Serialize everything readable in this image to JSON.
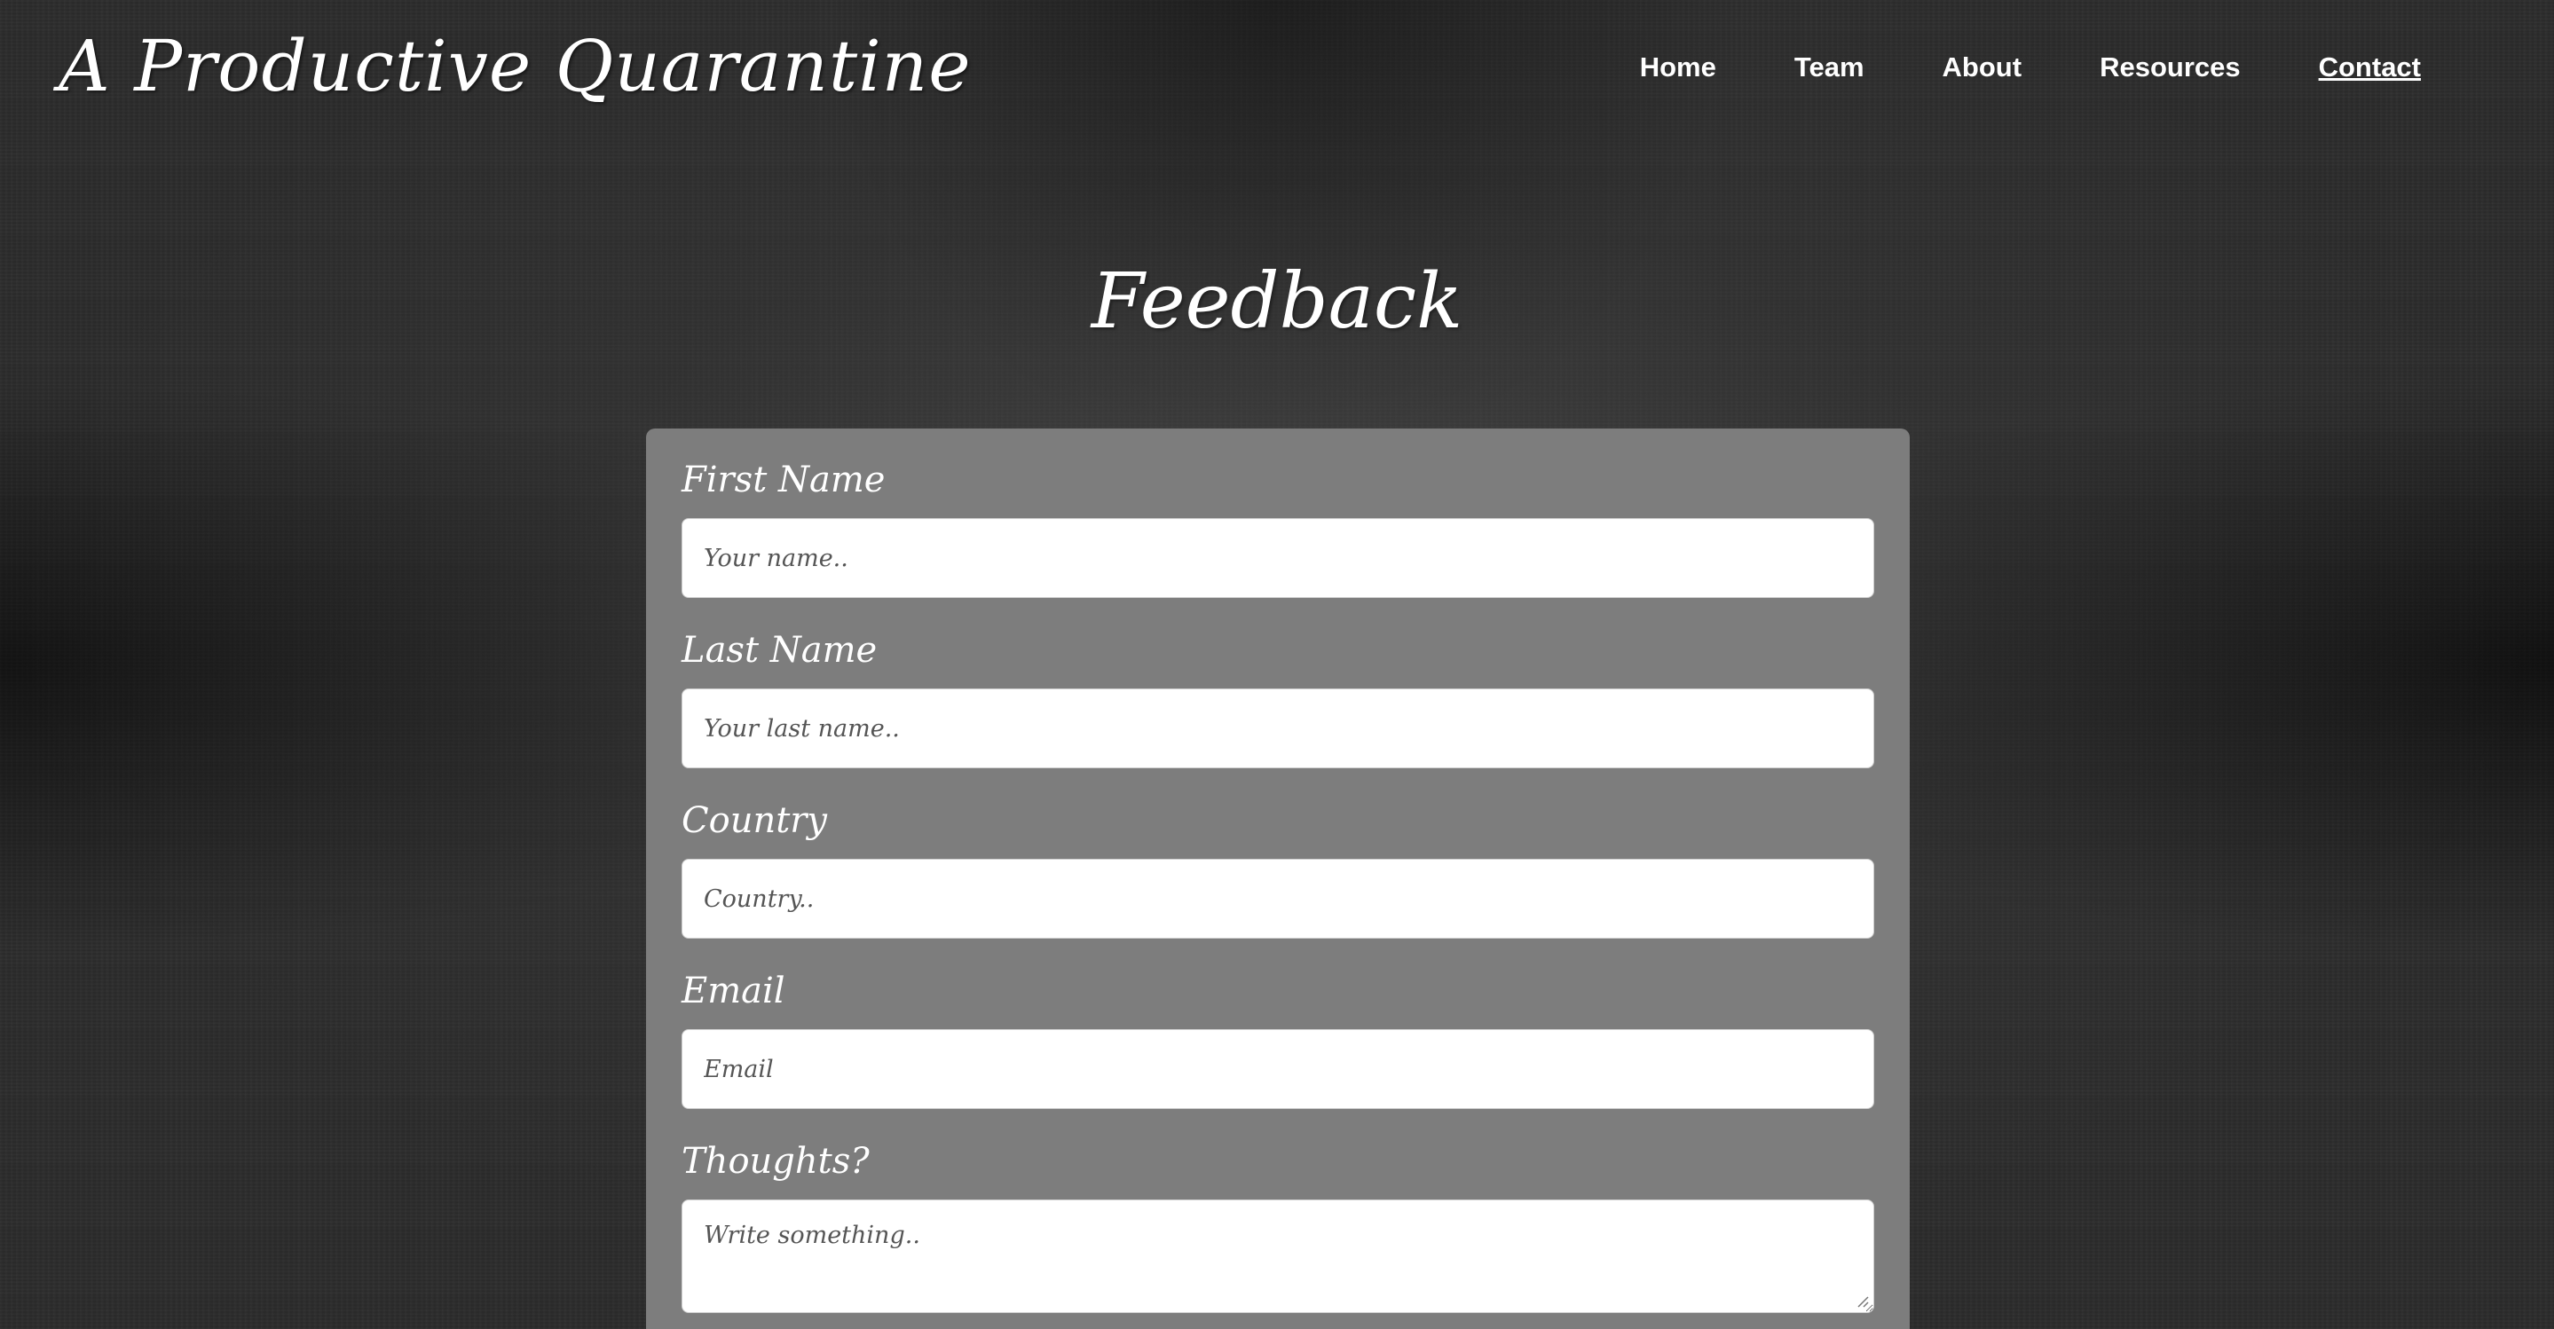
{
  "header": {
    "brand": "A Productive Quarantine",
    "nav": [
      {
        "label": "Home",
        "active": false
      },
      {
        "label": "Team",
        "active": false
      },
      {
        "label": "About",
        "active": false
      },
      {
        "label": "Resources",
        "active": false
      },
      {
        "label": "Contact",
        "active": true
      }
    ]
  },
  "main": {
    "title": "Feedback",
    "form": {
      "first_name": {
        "label": "First Name",
        "placeholder": "Your name..",
        "value": ""
      },
      "last_name": {
        "label": "Last Name",
        "placeholder": "Your last name..",
        "value": ""
      },
      "country": {
        "label": "Country",
        "placeholder": "Country..",
        "value": ""
      },
      "email": {
        "label": "Email",
        "placeholder": "Email",
        "value": ""
      },
      "thoughts": {
        "label": "Thoughts?",
        "placeholder": "Write something..",
        "value": ""
      }
    }
  },
  "colors": {
    "background": "#2c2c2c",
    "card": "#7d7d7d",
    "text": "#ffffff",
    "input_bg": "#ffffff"
  },
  "icons": {
    "textarea_resize": "resize-grip-icon"
  }
}
